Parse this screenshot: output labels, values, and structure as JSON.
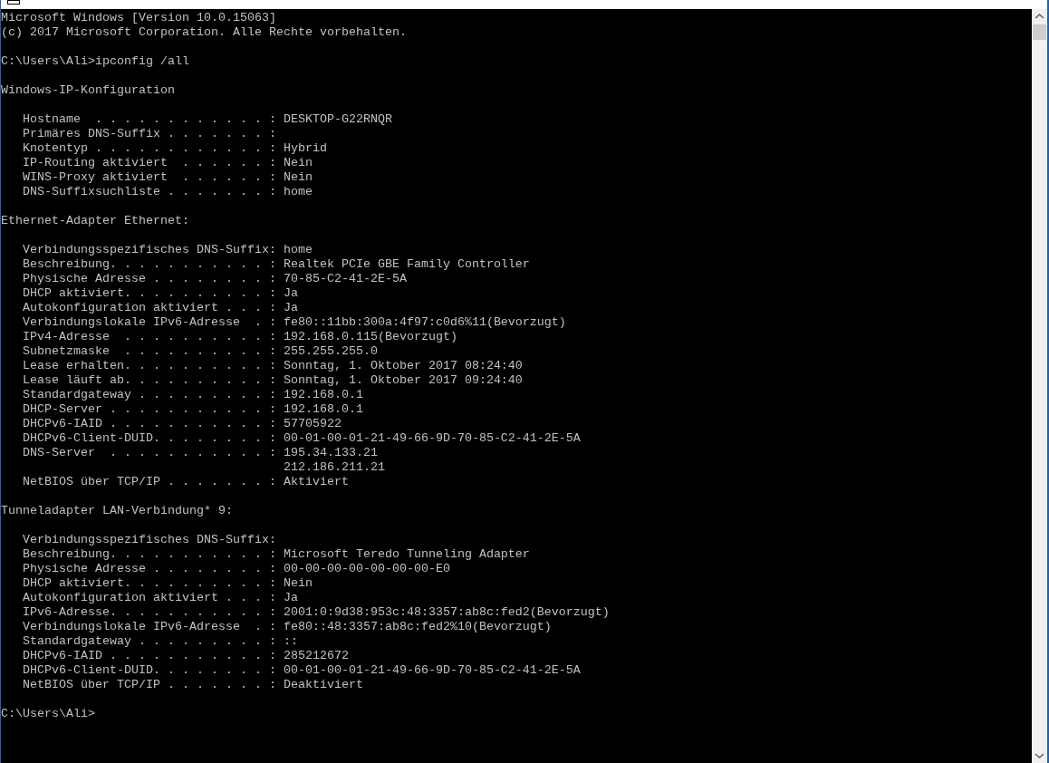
{
  "console": {
    "lines": [
      {
        "kind": "text",
        "text": "Microsoft Windows [Version 10.0.15063]"
      },
      {
        "kind": "text",
        "text": "(c) 2017 Microsoft Corporation. Alle Rechte vorbehalten."
      },
      {
        "kind": "blank"
      },
      {
        "kind": "text",
        "text": "C:\\Users\\Ali>ipconfig /all"
      },
      {
        "kind": "blank"
      },
      {
        "kind": "text",
        "text": "Windows-IP-Konfiguration"
      },
      {
        "kind": "blank"
      },
      {
        "kind": "text",
        "text": "   Hostname  . . . . . . . . . . . . : DESKTOP-G22RNQR"
      },
      {
        "kind": "text",
        "text": "   Primäres DNS-Suffix . . . . . . . :"
      },
      {
        "kind": "text",
        "text": "   Knotentyp . . . . . . . . . . . . : Hybrid"
      },
      {
        "kind": "text",
        "text": "   IP-Routing aktiviert  . . . . . . : Nein"
      },
      {
        "kind": "text",
        "text": "   WINS-Proxy aktiviert  . . . . . . : Nein"
      },
      {
        "kind": "text",
        "text": "   DNS-Suffixsuchliste . . . . . . . : home"
      },
      {
        "kind": "blank"
      },
      {
        "kind": "text",
        "text": "Ethernet-Adapter Ethernet:"
      },
      {
        "kind": "blank"
      },
      {
        "kind": "text",
        "text": "   Verbindungsspezifisches DNS-Suffix: home"
      },
      {
        "kind": "text",
        "text": "   Beschreibung. . . . . . . . . . . : Realtek PCIe GBE Family Controller"
      },
      {
        "kind": "text",
        "text": "   Physische Adresse . . . . . . . . : 70-85-C2-41-2E-5A"
      },
      {
        "kind": "text",
        "text": "   DHCP aktiviert. . . . . . . . . . : Ja"
      },
      {
        "kind": "text",
        "text": "   Autokonfiguration aktiviert . . . : Ja"
      },
      {
        "kind": "text",
        "text": "   Verbindungslokale IPv6-Adresse  . : fe80::11bb:300a:4f97:c0d6%11(Bevorzugt)"
      },
      {
        "kind": "text",
        "text": "   IPv4-Adresse  . . . . . . . . . . : 192.168.0.115(Bevorzugt)"
      },
      {
        "kind": "text",
        "text": "   Subnetzmaske  . . . . . . . . . . : 255.255.255.0"
      },
      {
        "kind": "text",
        "text": "   Lease erhalten. . . . . . . . . . : Sonntag, 1. Oktober 2017 08:24:40"
      },
      {
        "kind": "text",
        "text": "   Lease läuft ab. . . . . . . . . . : Sonntag, 1. Oktober 2017 09:24:40"
      },
      {
        "kind": "text",
        "text": "   Standardgateway . . . . . . . . . : 192.168.0.1"
      },
      {
        "kind": "text",
        "text": "   DHCP-Server . . . . . . . . . . . : 192.168.0.1"
      },
      {
        "kind": "text",
        "text": "   DHCPv6-IAID . . . . . . . . . . . : 57705922"
      },
      {
        "kind": "text",
        "text": "   DHCPv6-Client-DUID. . . . . . . . : 00-01-00-01-21-49-66-9D-70-85-C2-41-2E-5A"
      },
      {
        "kind": "text",
        "text": "   DNS-Server  . . . . . . . . . . . : 195.34.133.21"
      },
      {
        "kind": "text",
        "text": "                                       212.186.211.21"
      },
      {
        "kind": "text",
        "text": "   NetBIOS über TCP/IP . . . . . . . : Aktiviert"
      },
      {
        "kind": "blank"
      },
      {
        "kind": "text",
        "text": "Tunneladapter LAN-Verbindung* 9:"
      },
      {
        "kind": "blank"
      },
      {
        "kind": "text",
        "text": "   Verbindungsspezifisches DNS-Suffix:"
      },
      {
        "kind": "text",
        "text": "   Beschreibung. . . . . . . . . . . : Microsoft Teredo Tunneling Adapter"
      },
      {
        "kind": "text",
        "text": "   Physische Adresse . . . . . . . . : 00-00-00-00-00-00-00-E0"
      },
      {
        "kind": "text",
        "text": "   DHCP aktiviert. . . . . . . . . . : Nein"
      },
      {
        "kind": "text",
        "text": "   Autokonfiguration aktiviert . . . : Ja"
      },
      {
        "kind": "text",
        "text": "   IPv6-Adresse. . . . . . . . . . . : 2001:0:9d38:953c:48:3357:ab8c:fed2(Bevorzugt)"
      },
      {
        "kind": "text",
        "text": "   Verbindungslokale IPv6-Adresse  . : fe80::48:3357:ab8c:fed2%10(Bevorzugt)"
      },
      {
        "kind": "text",
        "text": "   Standardgateway . . . . . . . . . : ::"
      },
      {
        "kind": "text",
        "text": "   DHCPv6-IAID . . . . . . . . . . . : 285212672"
      },
      {
        "kind": "text",
        "text": "   DHCPv6-Client-DUID. . . . . . . . : 00-01-00-01-21-49-66-9D-70-85-C2-41-2E-5A"
      },
      {
        "kind": "text",
        "text": "   NetBIOS über TCP/IP . . . . . . . : Deaktiviert"
      },
      {
        "kind": "blank"
      },
      {
        "kind": "text",
        "text": "C:\\Users\\Ali>"
      }
    ]
  }
}
